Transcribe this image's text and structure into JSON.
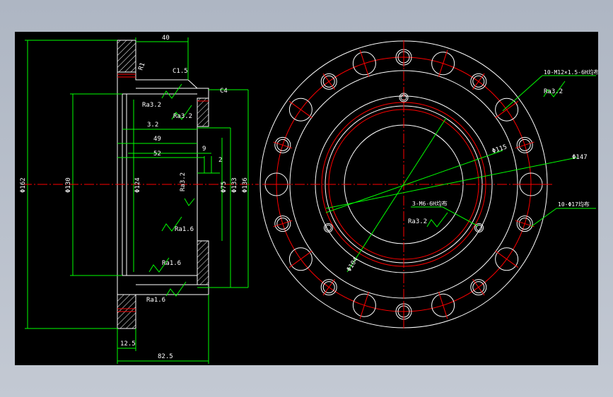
{
  "colors": {
    "background": "#000000",
    "outline": "#ffffff",
    "centerline": "#ff0000",
    "dimension": "#00ff00",
    "hatch": "#ffffff",
    "accent": "#ffff00"
  },
  "section_view": {
    "dims": {
      "width_40": "40",
      "phi_162": "Φ162",
      "phi_130": "Φ130",
      "phi_124": "Φ124",
      "phi_133": "Φ133",
      "phi_136": "Φ136",
      "phi_75": "Φ75",
      "d_12_5": "12.5",
      "d_82_5": "82.5",
      "d_49": "49",
      "d_52": "52",
      "d_9": "9",
      "d_2": "2",
      "d_3_2": "3.2",
      "chamfer_c1_5": "C1.5",
      "chamfer_c4": "C4",
      "r1": "R1"
    },
    "roughness": {
      "ra32_top": "Ra3.2",
      "ra32_mid": "Ra3.2",
      "ra32_vertical": "Ra3.2",
      "ra16_a": "Ra1.6",
      "ra16_b": "Ra1.6",
      "ra16_c": "Ra1.6"
    }
  },
  "front_view": {
    "dims": {
      "phi_115": "Φ115",
      "phi_147": "Φ147",
      "phi_104": "Φ104"
    },
    "callouts": {
      "holes_m12": "10-M12×1.5-6H均布",
      "holes_m6": "3-M6-6H均布",
      "holes_17": "10-Φ17均布",
      "ra32_m12": "Ra3.2",
      "ra32_m6": "Ra3.2"
    }
  }
}
